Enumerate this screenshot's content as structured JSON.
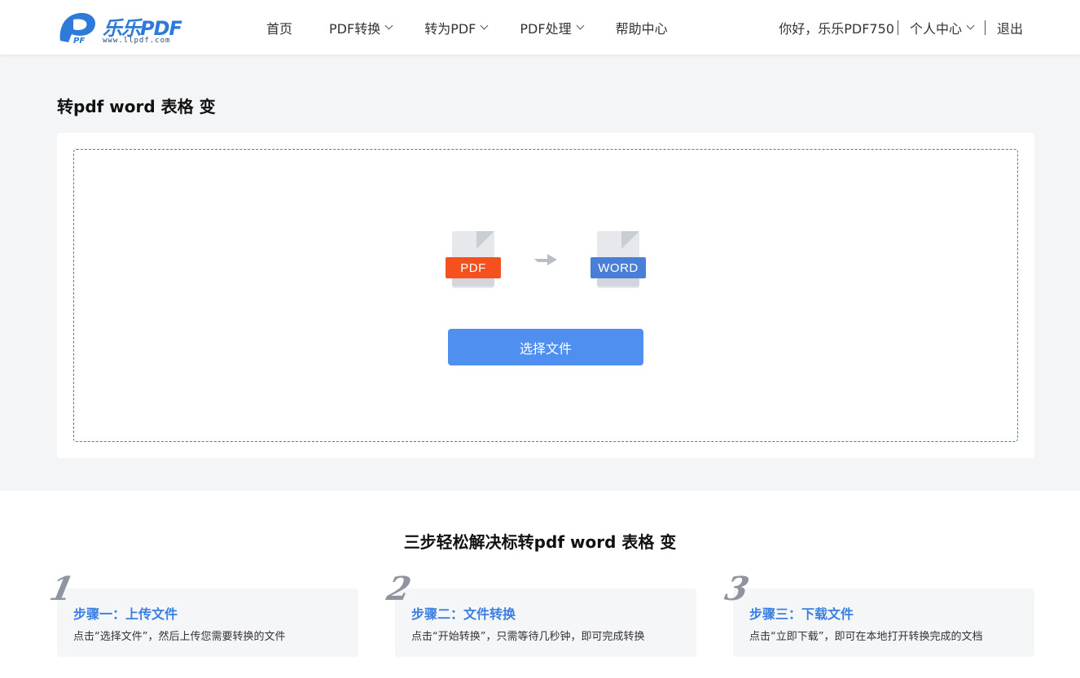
{
  "header": {
    "logo": {
      "name": "乐乐PDF",
      "url": "www.llpdf.com"
    },
    "nav": [
      {
        "label": "首页",
        "has_dropdown": false
      },
      {
        "label": "PDF转换",
        "has_dropdown": true
      },
      {
        "label": "转为PDF",
        "has_dropdown": true
      },
      {
        "label": "PDF处理",
        "has_dropdown": true
      },
      {
        "label": "帮助中心",
        "has_dropdown": false
      }
    ],
    "user": {
      "greeting": "你好，乐乐PDF750",
      "center_label": "个人中心",
      "logout_label": "退出"
    }
  },
  "main": {
    "title": "转pdf word 表格 变",
    "converter": {
      "from_label": "PDF",
      "to_label": "WORD",
      "select_button": "选择文件"
    }
  },
  "steps": {
    "title": "三步轻松解决标转pdf word 表格 变",
    "items": [
      {
        "number": "1",
        "title": "步骤一：上传文件",
        "desc": "点击“选择文件”，然后上传您需要转换的文件"
      },
      {
        "number": "2",
        "title": "步骤二：文件转换",
        "desc": "点击“开始转换”，只需等待几秒钟，即可完成转换"
      },
      {
        "number": "3",
        "title": "步骤三：下载文件",
        "desc": "点击“立即下载”，即可在本地打开转换完成的文档"
      }
    ]
  },
  "colors": {
    "brand": "#2d7ad8",
    "button": "#4f8ff0",
    "pdf": "#f4511e",
    "word": "#4a7fd8",
    "step_title": "#3b7fe0"
  }
}
